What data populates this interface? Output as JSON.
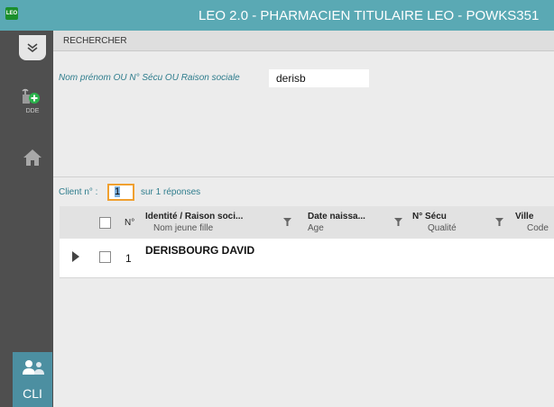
{
  "app": {
    "title": "LEO 2.0 - PHARMACIEN TITULAIRE LEO - POWKS351",
    "logo": "LEO"
  },
  "sidebar": {
    "dde_label": "DDE",
    "cli_label": "CLI"
  },
  "search": {
    "section_title": "RECHERCHER",
    "field_label": "Nom prénom OU N° Sécu OU Raison sociale",
    "value": "derisb"
  },
  "results": {
    "client_label": "Client n° :",
    "client_value": "1",
    "count_text": "sur 1 réponses"
  },
  "grid": {
    "columns": {
      "num": "N°",
      "identite": "Identité / Raison soci...",
      "identite_sub": "Nom jeune fille",
      "naissance": "Date naissa...",
      "naissance_sub": "Age",
      "secu": "N° Sécu",
      "secu_sub": "Qualité",
      "ville": "Ville",
      "ville_sub": "Code"
    },
    "rows": [
      {
        "num": "1",
        "name": "DERISBOURG DAVID"
      }
    ]
  },
  "colors": {
    "titlebar": "#5aa9b4",
    "sidebar": "#4f4f4f",
    "accent": "#2f7d8d",
    "active_tab": "#4c8fa1"
  }
}
